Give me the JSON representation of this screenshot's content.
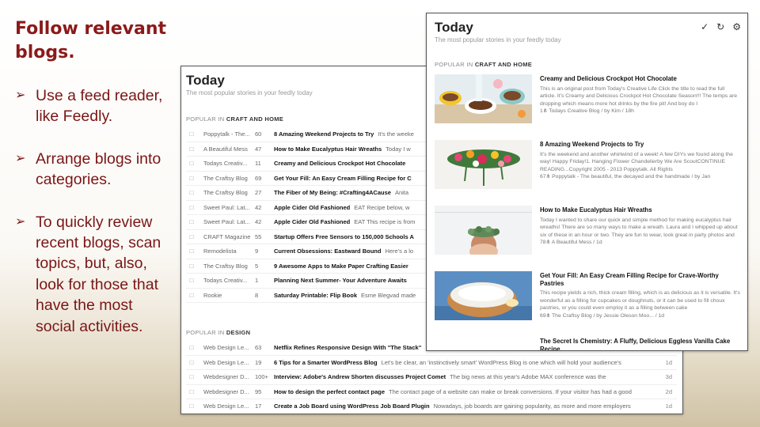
{
  "slide": {
    "title": "Follow relevant blogs.",
    "bullets": [
      "Use a feed reader, like Feedly.",
      "Arrange blogs into categories.",
      "To quickly review recent blogs, scan topics, but, also, look for those that have the most social activities."
    ]
  },
  "back_panel": {
    "title": "Today",
    "subtitle": "The most popular stories in your feedly today",
    "sections": [
      {
        "prefix": "POPULAR IN",
        "name": "CRAFT AND HOME",
        "rows": [
          {
            "source": "Poppytalk - The...",
            "count": "60",
            "title": "8 Amazing Weekend Projects to Try",
            "snippet": "It's the weeke",
            "age": ""
          },
          {
            "source": "A Beautiful Mess",
            "count": "47",
            "title": "How to Make Eucalyptus Hair Wreaths",
            "snippet": "Today I w",
            "age": ""
          },
          {
            "source": "Todays Creativ...",
            "count": "11",
            "title": "Creamy and Delicious Crockpot Hot Chocolate",
            "snippet": "",
            "age": ""
          },
          {
            "source": "The Craftsy Blog",
            "count": "69",
            "title": "Get Your Fill: An Easy Cream Filling Recipe for C",
            "snippet": "",
            "age": ""
          },
          {
            "source": "The Craftsy Blog",
            "count": "27",
            "title": "The Fiber of My Being: #Crafting4ACause",
            "snippet": "Anita",
            "age": ""
          },
          {
            "source": "Sweet Paul: Lat...",
            "count": "42",
            "title": "Apple Cider Old Fashioned",
            "snippet": "EAT Recipe below, w",
            "age": ""
          },
          {
            "source": "Sweet Paul: Lat...",
            "count": "42",
            "title": "Apple Cider Old Fashioned",
            "snippet": "EAT This recipe is from",
            "age": ""
          },
          {
            "source": "CRAFT Magazine",
            "count": "55",
            "title": "Startup Offers Free Sensors to 150,000 Schools A",
            "snippet": "",
            "age": ""
          },
          {
            "source": "Remodelista",
            "count": "9",
            "title": "Current Obsessions: Eastward Bound",
            "snippet": "Here's a lo",
            "age": ""
          },
          {
            "source": "The Craftsy Blog",
            "count": "5",
            "title": "9 Awesome Apps to Make Paper Crafting Easier",
            "snippet": "",
            "age": ""
          },
          {
            "source": "Todays Creativ...",
            "count": "1",
            "title": "Planning Next Summer- Your Adventure Awaits",
            "snippet": "",
            "age": ""
          },
          {
            "source": "Rookie",
            "count": "8",
            "title": "Saturday Printable: Flip Book",
            "snippet": "Esme Blegvad made",
            "age": ""
          }
        ]
      },
      {
        "prefix": "POPULAR IN",
        "name": "DESIGN",
        "rows": [
          {
            "source": "Web Design Le...",
            "count": "63",
            "title": "Netflix Refines Responsive Design With \"The Stack\"",
            "snippet": "",
            "age": ""
          },
          {
            "source": "Web Design Le...",
            "count": "19",
            "title": "6 Tips for a Smarter WordPress Blog",
            "snippet": "Let's be clear, an 'instinctively smart' WordPress Blog is one which will hold your audience's",
            "age": "1d"
          },
          {
            "source": "Webdesigner D...",
            "count": "100+",
            "title": "Interview: Adobe's Andrew Shorten discusses Project Comet",
            "snippet": "The big news at this year's Adobe MAX conference was the",
            "age": "3d"
          },
          {
            "source": "Webdesigner D...",
            "count": "95",
            "title": "How to design the perfect contact page",
            "snippet": "The contact page of a website can make or break conversions. If your visitor has had a good",
            "age": "2d"
          },
          {
            "source": "Web Design Le...",
            "count": "17",
            "title": "Create a Job Board using WordPress Job Board Plugin",
            "snippet": "Nowadays, job boards are gaining popularity, as more and more employers",
            "age": "1d"
          }
        ]
      }
    ]
  },
  "front_panel": {
    "title": "Today",
    "subtitle": "The most popular stories in your feedly today",
    "section_prefix": "POPULAR IN",
    "section_name": "CRAFT AND HOME",
    "tools": {
      "check": "✓",
      "refresh": "↻",
      "settings": "⚙"
    },
    "cards": [
      {
        "title": "Creamy and Delicious Crockpot Hot Chocolate",
        "body": "This is an original post from Today's Creative Life Click the title to read the full article. It's Creamy and Delicious Crockpot Hot Chocolate Season!!! The temps are dropping which means more hot drinks by the fire pit! And boy do I",
        "meta": "1⋔ Todays Creative Blog / by Kim / 18h"
      },
      {
        "title": "8 Amazing Weekend Projects to Try",
        "body": "It's the weekend and another whirlwind of a week! A few DIYs we found along the way! Happy Friday!1. Hanging Flower Chandelierby We Are ScoutCONTINUE READING...Copyright 2005 - 2013 Poppytalk. All Rights",
        "meta": "67⋔ Poppytalk - The beautiful, the decayed and the handmade / by Jan"
      },
      {
        "title": "How to Make Eucalyptus Hair Wreaths",
        "body": "Today I wanted to share our quick and simple method for making eucalyptus hair wreaths! There are so many ways to make a wreath. Laura and I whipped up about six of these in an hour or two. They are fun to wear, look great in party photos and",
        "meta": "78⋔ A Beautiful Mess / 1d"
      },
      {
        "title": "Get Your Fill: An Easy Cream Filling Recipe for Crave-Worthy Pastries",
        "body": "This recipe yields a rich, thick cream filling, which is as delicious as it is versatile. It's wonderful as a filling for cupcakes or doughnuts, or it can be used to fill choux pastries, or you could even employ it as a filling between cake",
        "meta": "69⋔ The Craftsy Blog / by Jessie Oleson Moo... / 1d"
      },
      {
        "title": "The Secret Is Chemistry: A Fluffy, Delicious Eggless Vanilla Cake Recipe",
        "body": "",
        "meta": ""
      }
    ]
  },
  "colors": {
    "title_red": "#8b1a1a",
    "bullet_red": "#7a1616"
  }
}
